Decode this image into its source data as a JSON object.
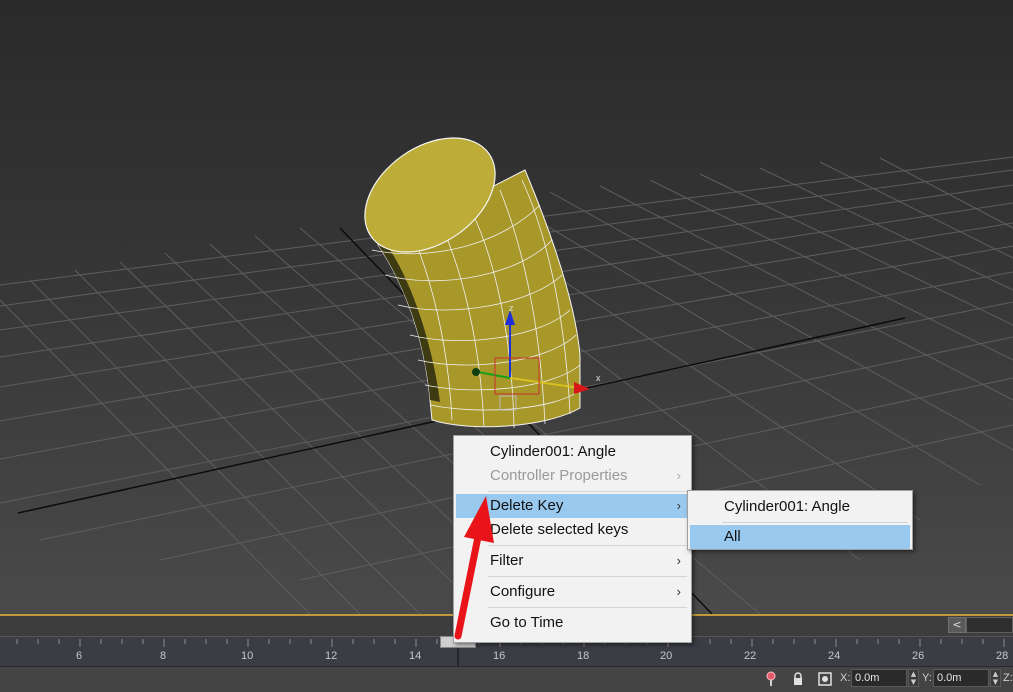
{
  "context_menu": {
    "items": [
      {
        "label": "Cylinder001: Angle",
        "disabled": false,
        "submenu": false,
        "highlighted": false
      },
      {
        "label": "Controller Properties",
        "disabled": true,
        "submenu": true,
        "highlighted": false
      },
      {
        "label": "Delete Key",
        "disabled": false,
        "submenu": true,
        "highlighted": true
      },
      {
        "label": "Delete selected keys",
        "disabled": false,
        "submenu": false,
        "highlighted": false
      },
      {
        "label": "Filter",
        "disabled": false,
        "submenu": true,
        "highlighted": false
      },
      {
        "label": "Configure",
        "disabled": false,
        "submenu": true,
        "highlighted": false
      },
      {
        "label": "Go to Time",
        "disabled": false,
        "submenu": false,
        "highlighted": false
      }
    ],
    "submenu_arrow": "›"
  },
  "submenu": {
    "items": [
      {
        "label": "Cylinder001: Angle",
        "highlighted": false
      },
      {
        "label": "All",
        "highlighted": true
      }
    ]
  },
  "timeline": {
    "tick_labels": [
      "6",
      "8",
      "10",
      "12",
      "14",
      "16",
      "18",
      "20",
      "22",
      "24",
      "26",
      "28"
    ],
    "back_button": "<"
  },
  "statusbar": {
    "icons": [
      "key-mode-icon",
      "lock-icon",
      "selection-icon"
    ],
    "x_label": "X:",
    "x_value": "0.0m",
    "y_label": "Y:",
    "y_value": "0.0m",
    "z_label": "Z:"
  },
  "viewport": {
    "gizmo_labels": {
      "z": "z",
      "x": "x"
    }
  },
  "colors": {
    "highlight": "#99c9ef",
    "object": "#b8a832",
    "timeline_accent": "#c09a3a",
    "annotation_arrow": "#e8141a"
  }
}
